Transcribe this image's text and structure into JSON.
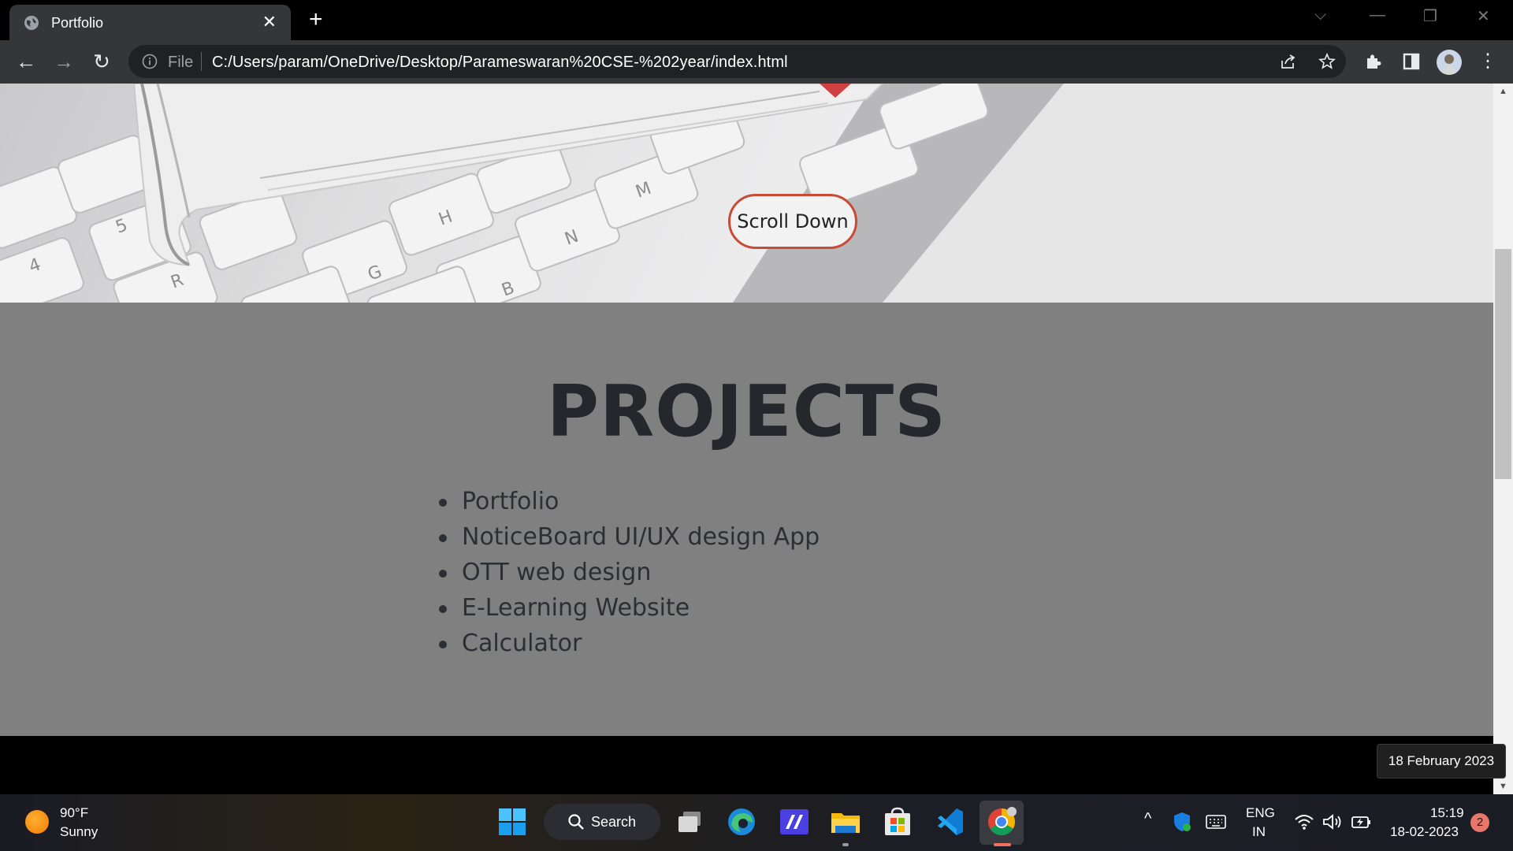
{
  "browser": {
    "tab_title": "Portfolio",
    "address_scheme_label": "File",
    "url": "C:/Users/param/OneDrive/Desktop/Parameswaran%20CSE-%202year/index.html"
  },
  "page": {
    "hero": {
      "scroll_button_label": "Scroll Down"
    },
    "projects": {
      "heading": "PROJECTS",
      "items": [
        "Portfolio",
        "NoticeBoard UI/UX design App",
        "OTT web design",
        "E-Learning Website",
        "Calculator"
      ]
    },
    "colors": {
      "projects_background": "#808080",
      "button_border": "#c84b36",
      "footer_background": "#000000"
    }
  },
  "tooltip": {
    "text": "18 February 2023"
  },
  "taskbar": {
    "weather": {
      "temperature": "90°F",
      "condition": "Sunny"
    },
    "search_label": "Search",
    "apps": [
      "start-icon",
      "search-icon",
      "task-view-icon",
      "edge-icon",
      "text-editor-icon",
      "file-explorer-icon",
      "store-icon",
      "vscode-icon",
      "chrome-icon"
    ],
    "language": {
      "line1": "ENG",
      "line2": "IN"
    },
    "clock": {
      "time": "15:19",
      "date": "18-02-2023"
    },
    "notification_count": "2"
  }
}
